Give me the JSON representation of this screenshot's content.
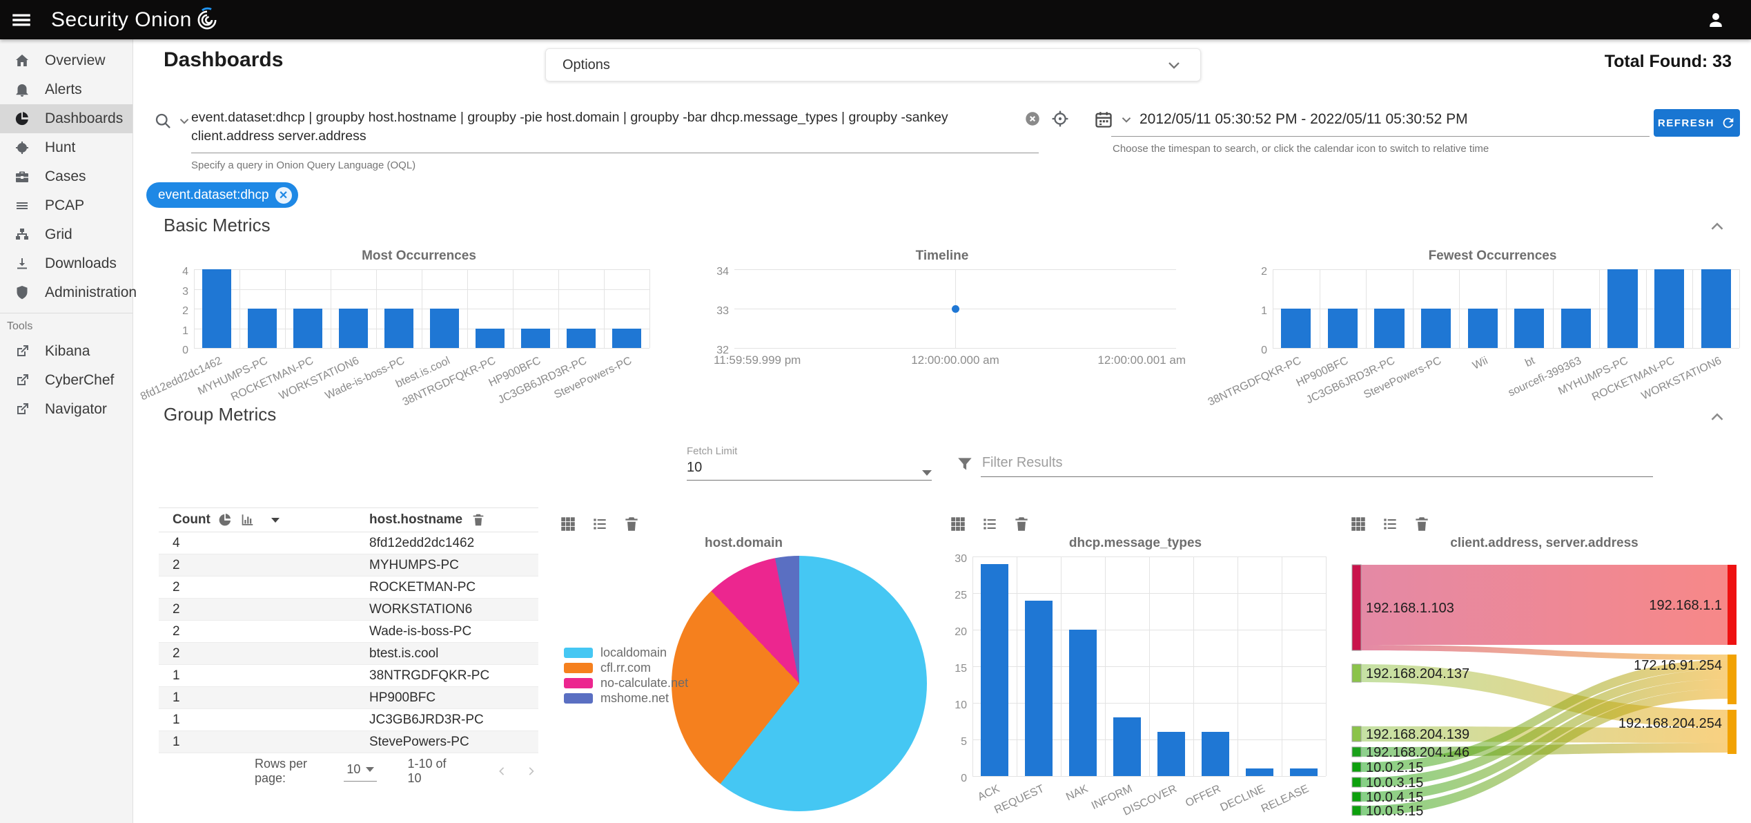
{
  "app": {
    "brand": "Security Onion",
    "total_found": "Total Found: 33"
  },
  "sidebar": {
    "items": [
      {
        "label": "Overview"
      },
      {
        "label": "Alerts"
      },
      {
        "label": "Dashboards"
      },
      {
        "label": "Hunt"
      },
      {
        "label": "Cases"
      },
      {
        "label": "PCAP"
      },
      {
        "label": "Grid"
      },
      {
        "label": "Downloads"
      },
      {
        "label": "Administration"
      }
    ],
    "tools_label": "Tools",
    "tools": [
      {
        "label": "Kibana"
      },
      {
        "label": "CyberChef"
      },
      {
        "label": "Navigator"
      }
    ]
  },
  "header": {
    "page_title": "Dashboards",
    "options_label": "Options"
  },
  "search": {
    "query": "event.dataset:dhcp | groupby host.hostname | groupby -pie host.domain | groupby -bar dhcp.message_types | groupby -sankey client.address server.address",
    "hint": "Specify a query in Onion Query Language (OQL)"
  },
  "timerange": {
    "value": "2012/05/11 05:30:52 PM - 2022/05/11 05:30:52 PM",
    "hint": "Choose the timespan to search, or click the calendar icon to switch to relative time",
    "refresh_label": "REFRESH"
  },
  "filter_chip": {
    "label": "event.dataset:dhcp"
  },
  "sections": {
    "basic": "Basic Metrics",
    "group": "Group Metrics"
  },
  "controls": {
    "fetch_limit_label": "Fetch Limit",
    "fetch_limit_value": "10",
    "filter_placeholder": "Filter Results"
  },
  "table": {
    "col_count": "Count",
    "col_value": "host.hostname",
    "rows": [
      {
        "count": "4",
        "value": "8fd12edd2dc1462"
      },
      {
        "count": "2",
        "value": "MYHUMPS-PC"
      },
      {
        "count": "2",
        "value": "ROCKETMAN-PC"
      },
      {
        "count": "2",
        "value": "WORKSTATION6"
      },
      {
        "count": "2",
        "value": "Wade-is-boss-PC"
      },
      {
        "count": "2",
        "value": "btest.is.cool"
      },
      {
        "count": "1",
        "value": "38NTRGDFQKR-PC"
      },
      {
        "count": "1",
        "value": "HP900BFC"
      },
      {
        "count": "1",
        "value": "JC3GB6JRD3R-PC"
      },
      {
        "count": "1",
        "value": "StevePowers-PC"
      }
    ],
    "footer": {
      "rows_per_page": "Rows per page:",
      "per_page": "10",
      "range": "1-10 of 10"
    }
  },
  "colors": {
    "accent": "#1976d2",
    "bar": "#1f77d4",
    "chip": "#1e88e5"
  },
  "chart_data": [
    {
      "id": "most_occurrences",
      "type": "bar",
      "title": "Most Occurrences",
      "categories": [
        "8fd12edd2dc1462",
        "MYHUMPS-PC",
        "ROCKETMAN-PC",
        "WORKSTATION6",
        "Wade-is-boss-PC",
        "btest.is.cool",
        "38NTRGDFQKR-PC",
        "HP900BFC",
        "JC3GB6JRD3R-PC",
        "StevePowers-PC"
      ],
      "values": [
        4,
        2,
        2,
        2,
        2,
        2,
        1,
        1,
        1,
        1
      ],
      "ylim": [
        0,
        4
      ],
      "yticks": [
        0,
        1,
        2,
        3,
        4
      ],
      "grid": true
    },
    {
      "id": "timeline",
      "type": "scatter",
      "title": "Timeline",
      "x_labels": [
        "11:59:59.999 pm",
        "12:00:00.000 am",
        "12:00:00.001 am"
      ],
      "yticks": [
        32,
        33,
        34
      ],
      "ylim": [
        32,
        34
      ],
      "points": [
        {
          "x": "12:00:00.000 am",
          "y": 33
        }
      ],
      "grid": true
    },
    {
      "id": "fewest_occurrences",
      "type": "bar",
      "title": "Fewest Occurrences",
      "categories": [
        "38NTRGDFQKR-PC",
        "HP900BFC",
        "JC3GB6JRD3R-PC",
        "StevePowers-PC",
        "Wii",
        "bt",
        "sourcefi-399363",
        "MYHUMPS-PC",
        "ROCKETMAN-PC",
        "WORKSTATION6"
      ],
      "values": [
        1,
        1,
        1,
        1,
        1,
        1,
        1,
        2,
        2,
        2
      ],
      "ylim": [
        0,
        2
      ],
      "yticks": [
        0,
        1,
        2
      ],
      "grid": true
    },
    {
      "id": "host_domain",
      "type": "pie",
      "title": "host.domain",
      "labels": [
        "localdomain",
        "cfl.rr.com",
        "no-calculate.net",
        "mshome.net"
      ],
      "values": [
        20,
        9,
        3,
        1
      ],
      "colors": [
        "#45c7f3",
        "#f5801e",
        "#ec268f",
        "#5a6fc2"
      ],
      "legend_position": "left"
    },
    {
      "id": "dhcp_message_types",
      "type": "bar",
      "title": "dhcp.message_types",
      "categories": [
        "ACK",
        "REQUEST",
        "NAK",
        "INFORM",
        "DISCOVER",
        "OFFER",
        "DECLINE",
        "RELEASE"
      ],
      "values": [
        29,
        24,
        20,
        8,
        6,
        6,
        1,
        1
      ],
      "ylim": [
        0,
        30
      ],
      "yticks": [
        0,
        5,
        10,
        15,
        20,
        25,
        30
      ],
      "grid": true
    },
    {
      "id": "client_server_sankey",
      "type": "sankey",
      "title": "client.address, server.address",
      "nodes": [
        {
          "id": "192.168.1.103",
          "color": "#c9134b"
        },
        {
          "id": "192.168.204.137",
          "color": "#8bc34a"
        },
        {
          "id": "192.168.204.139",
          "color": "#8bc34a"
        },
        {
          "id": "192.168.204.146",
          "color": "#1ba11b"
        },
        {
          "id": "10.0.2.15",
          "color": "#0da00d"
        },
        {
          "id": "10.0.3.15",
          "color": "#0da00d"
        },
        {
          "id": "10.0.4.15",
          "color": "#0da00d"
        },
        {
          "id": "10.0.5.15",
          "color": "#0da00d"
        },
        {
          "id": "192.168.1.1",
          "color": "#ee1111"
        },
        {
          "id": "172.16.91.254",
          "color": "#f2a202"
        },
        {
          "id": "192.168.204.254",
          "color": "#f2a202"
        }
      ],
      "links": [
        {
          "source": "192.168.1.103",
          "target": "192.168.1.1",
          "value": 10
        },
        {
          "source": "192.168.1.103",
          "target": "172.16.91.254",
          "value": 1
        },
        {
          "source": "192.168.204.137",
          "target": "192.168.204.254",
          "value": 2
        },
        {
          "source": "192.168.204.139",
          "target": "192.168.204.254",
          "value": 2
        },
        {
          "source": "192.168.204.146",
          "target": "192.168.204.254",
          "value": 1
        },
        {
          "source": "10.0.2.15",
          "target": "172.16.91.254",
          "value": 1
        },
        {
          "source": "10.0.3.15",
          "target": "172.16.91.254",
          "value": 1
        },
        {
          "source": "10.0.4.15",
          "target": "172.16.91.254",
          "value": 1
        },
        {
          "source": "10.0.5.15",
          "target": "172.16.91.254",
          "value": 1
        }
      ]
    }
  ]
}
